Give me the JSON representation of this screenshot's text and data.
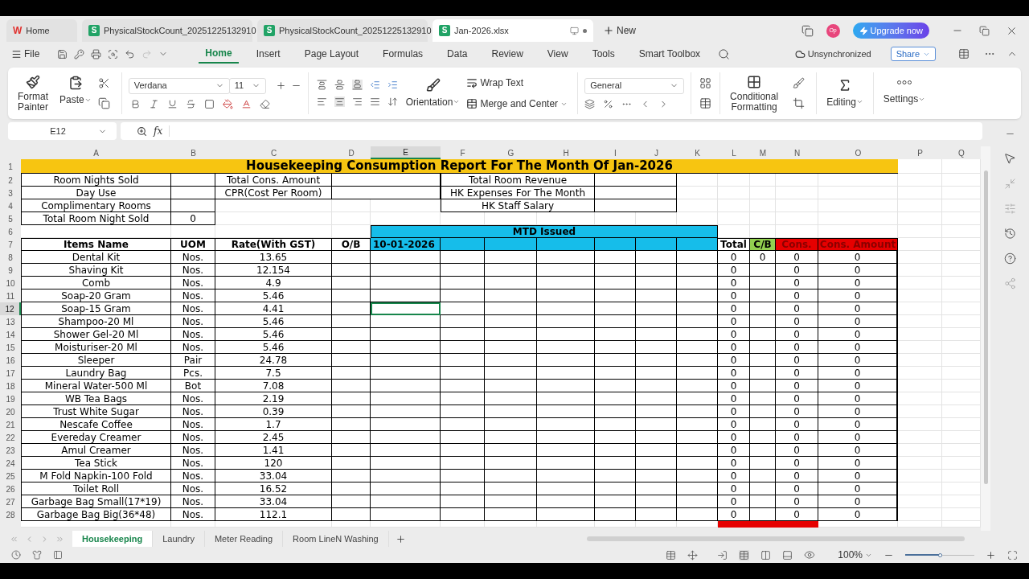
{
  "browser_tabs": [
    {
      "label": "Home",
      "icon": "W",
      "kind": "home",
      "selected": false
    },
    {
      "label": "PhysicalStockCount_20251225132910",
      "icon": "S",
      "kind": "sheet",
      "selected": false
    },
    {
      "label": "PhysicalStockCount_20251225132910",
      "icon": "S",
      "kind": "sheet",
      "selected": false
    },
    {
      "label": "Jan-2026.xlsx",
      "icon": "S",
      "kind": "sheet",
      "selected": true
    }
  ],
  "new_tab": "New",
  "avatar": "Op",
  "upgrade": "Upgrade now",
  "file_menu": "File",
  "ribbon_tabs": [
    {
      "label": "Home",
      "selected": true
    },
    {
      "label": "Insert",
      "selected": false
    },
    {
      "label": "Page Layout",
      "selected": false
    },
    {
      "label": "Formulas",
      "selected": false
    },
    {
      "label": "Data",
      "selected": false
    },
    {
      "label": "Review",
      "selected": false
    },
    {
      "label": "View",
      "selected": false
    },
    {
      "label": "Tools",
      "selected": false
    },
    {
      "label": "Smart Toolbox",
      "selected": false
    }
  ],
  "sync_status": "Unsynchronized",
  "share": "Share",
  "ribbon": {
    "format_painter": "Format Painter",
    "paste": "Paste",
    "font": "Verdana",
    "font_size": "11",
    "wrap_text": "Wrap Text",
    "orientation": "Orientation",
    "merge": "Merge and Center",
    "number_format": "General",
    "conditional": "Conditional Formatting",
    "editing": "Editing",
    "settings": "Settings"
  },
  "name_box": "E12",
  "fx": "fx",
  "columns": [
    {
      "label": "A",
      "selected": false
    },
    {
      "label": "B",
      "selected": false
    },
    {
      "label": "C",
      "selected": false
    },
    {
      "label": "D",
      "selected": false
    },
    {
      "label": "E",
      "selected": true
    },
    {
      "label": "F",
      "selected": false
    },
    {
      "label": "G",
      "selected": false
    },
    {
      "label": "H",
      "selected": false
    },
    {
      "label": "I",
      "selected": false
    },
    {
      "label": "J",
      "selected": false
    },
    {
      "label": "K",
      "selected": false
    },
    {
      "label": "L",
      "selected": false
    },
    {
      "label": "M",
      "selected": false
    },
    {
      "label": "N",
      "selected": false
    },
    {
      "label": "O",
      "selected": false
    },
    {
      "label": "P",
      "selected": false
    },
    {
      "label": "Q",
      "selected": false
    }
  ],
  "row_numbers": [
    {
      "label": "1",
      "selected": false
    },
    {
      "label": "2",
      "selected": false
    },
    {
      "label": "3",
      "selected": false
    },
    {
      "label": "4",
      "selected": false
    },
    {
      "label": "5",
      "selected": false
    },
    {
      "label": "6",
      "selected": false
    },
    {
      "label": "7",
      "selected": false
    },
    {
      "label": "8",
      "selected": false
    },
    {
      "label": "9",
      "selected": false
    },
    {
      "label": "10",
      "selected": false
    },
    {
      "label": "11",
      "selected": false
    },
    {
      "label": "12",
      "selected": true
    },
    {
      "label": "13",
      "selected": false
    },
    {
      "label": "14",
      "selected": false
    },
    {
      "label": "15",
      "selected": false
    },
    {
      "label": "16",
      "selected": false
    },
    {
      "label": "17",
      "selected": false
    },
    {
      "label": "18",
      "selected": false
    },
    {
      "label": "19",
      "selected": false
    },
    {
      "label": "20",
      "selected": false
    },
    {
      "label": "21",
      "selected": false
    },
    {
      "label": "22",
      "selected": false
    },
    {
      "label": "23",
      "selected": false
    },
    {
      "label": "24",
      "selected": false
    },
    {
      "label": "25",
      "selected": false
    },
    {
      "label": "26",
      "selected": false
    },
    {
      "label": "27",
      "selected": false
    },
    {
      "label": "28",
      "selected": false
    }
  ],
  "title": "Housekeeping Consumption Report For The Month Of Jan-2026",
  "summary_left": [
    {
      "label": "Room Nights Sold"
    },
    {
      "label": "Day Use"
    },
    {
      "label": "Complimentary Rooms"
    },
    {
      "label": "Total Room Night Sold",
      "value": "0"
    }
  ],
  "summary_mid": [
    "Total Cons. Amount",
    "CPR(Cost Per Room)"
  ],
  "summary_right": [
    "Total Room Revenue",
    "HK Expenses For The Month",
    "HK Staff Salary"
  ],
  "mtd_header": "MTD Issued",
  "headers": {
    "item": "Items Name",
    "uom": "UOM",
    "rate": "Rate(With GST)",
    "ob": "O/B",
    "date": "10-01-2026",
    "total": "Total",
    "cb": "C/B",
    "cons": "Cons.",
    "amount": "Cons. Amount"
  },
  "items": [
    {
      "name": "Dental Kit",
      "uom": "Nos.",
      "rate": "13.65",
      "total": "0",
      "cb": "0",
      "cons": "0",
      "amount": "0"
    },
    {
      "name": "Shaving Kit",
      "uom": "Nos.",
      "rate": "12.154",
      "total": "0",
      "cons": "0",
      "amount": "0"
    },
    {
      "name": "Comb",
      "uom": "Nos.",
      "rate": "4.9",
      "total": "0",
      "cons": "0",
      "amount": "0"
    },
    {
      "name": "Soap-20 Gram",
      "uom": "Nos.",
      "rate": "5.46",
      "total": "0",
      "cons": "0",
      "amount": "0"
    },
    {
      "name": "Soap-15 Gram",
      "uom": "Nos.",
      "rate": "4.41",
      "total": "0",
      "cons": "0",
      "amount": "0"
    },
    {
      "name": "Shampoo-20 Ml",
      "uom": "Nos.",
      "rate": "5.46",
      "total": "0",
      "cons": "0",
      "amount": "0"
    },
    {
      "name": "Shower Gel-20 Ml",
      "uom": "Nos.",
      "rate": "5.46",
      "total": "0",
      "cons": "0",
      "amount": "0"
    },
    {
      "name": "Moisturiser-20 Ml",
      "uom": "Nos.",
      "rate": "5.46",
      "total": "0",
      "cons": "0",
      "amount": "0"
    },
    {
      "name": "Sleeper",
      "uom": "Pair",
      "rate": "24.78",
      "total": "0",
      "cons": "0",
      "amount": "0"
    },
    {
      "name": "Laundry Bag",
      "uom": "Pcs.",
      "rate": "7.5",
      "total": "0",
      "cons": "0",
      "amount": "0"
    },
    {
      "name": "Mineral Water-500 Ml",
      "uom": "Bot",
      "rate": "7.08",
      "total": "0",
      "cons": "0",
      "amount": "0"
    },
    {
      "name": "WB Tea Bags",
      "uom": "Nos.",
      "rate": "2.19",
      "total": "0",
      "cons": "0",
      "amount": "0"
    },
    {
      "name": "Trust White Sugar",
      "uom": "Nos.",
      "rate": "0.39",
      "total": "0",
      "cons": "0",
      "amount": "0"
    },
    {
      "name": "Nescafe Coffee",
      "uom": "Nos.",
      "rate": "1.7",
      "total": "0",
      "cons": "0",
      "amount": "0"
    },
    {
      "name": "Evereday Creamer",
      "uom": "Nos.",
      "rate": "2.45",
      "total": "0",
      "cons": "0",
      "amount": "0"
    },
    {
      "name": "Amul Creamer",
      "uom": "Nos.",
      "rate": "1.41",
      "total": "0",
      "cons": "0",
      "amount": "0"
    },
    {
      "name": "Tea Stick",
      "uom": "Nos.",
      "rate": "120",
      "total": "0",
      "cons": "0",
      "amount": "0"
    },
    {
      "name": "M Fold Napkin-100 Fold",
      "uom": "Nos.",
      "rate": "33.04",
      "total": "0",
      "cons": "0",
      "amount": "0"
    },
    {
      "name": "Toilet Roll",
      "uom": "Nos.",
      "rate": "16.52",
      "total": "0",
      "cons": "0",
      "amount": "0"
    },
    {
      "name": "Garbage Bag Small(17*19)",
      "uom": "Nos.",
      "rate": "33.04",
      "total": "0",
      "cons": "0",
      "amount": "0"
    },
    {
      "name": "Garbage Bag Big(36*48)",
      "uom": "Nos.",
      "rate": "112.1",
      "total": "0",
      "cons": "0",
      "amount": "0"
    }
  ],
  "sheet_tabs": [
    {
      "label": "Housekeeping",
      "selected": true
    },
    {
      "label": "Laundry",
      "selected": false
    },
    {
      "label": "Meter Reading",
      "selected": false
    },
    {
      "label": "Room LineN Washing",
      "selected": false
    }
  ],
  "zoom": {
    "label": "100%",
    "level": 0.5
  }
}
